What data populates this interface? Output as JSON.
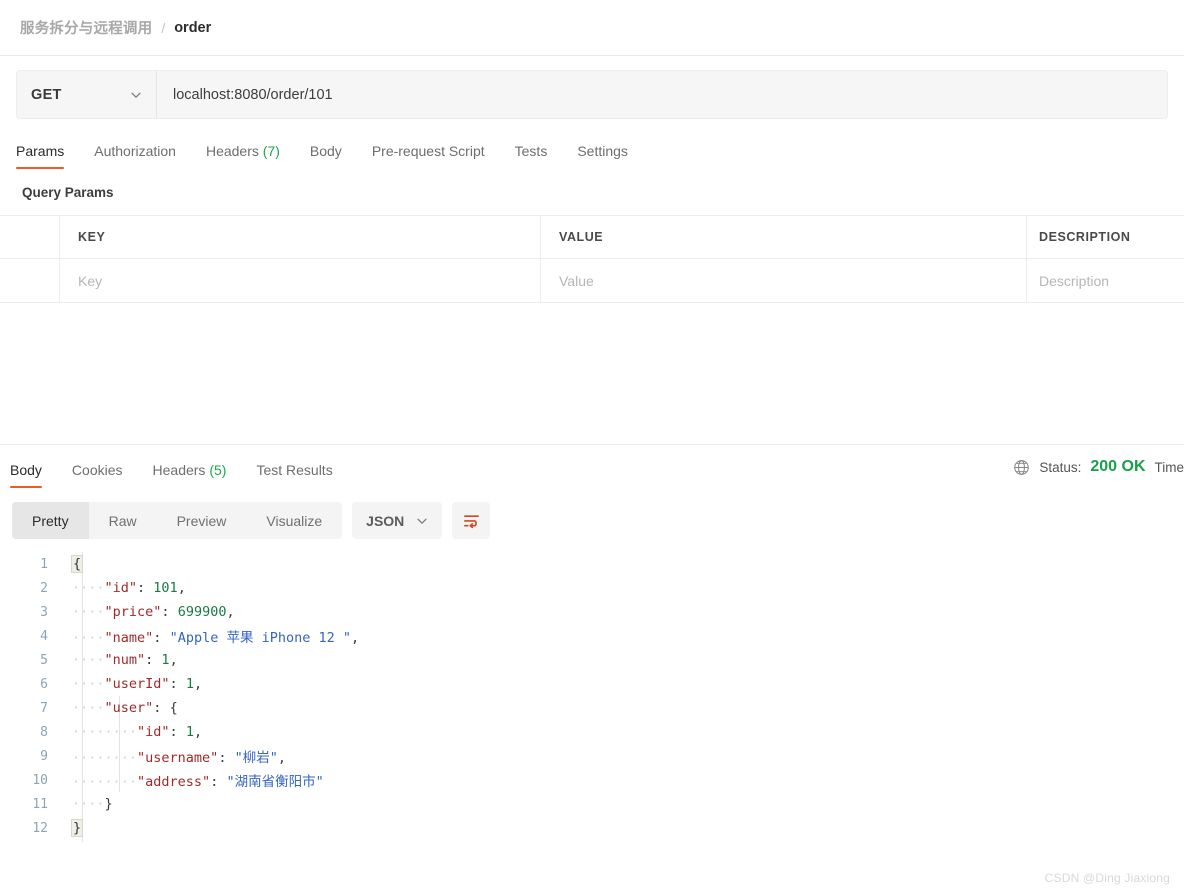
{
  "breadcrumb": {
    "collection": "服务拆分与远程调用",
    "separator": "/",
    "current": "order"
  },
  "request": {
    "method": "GET",
    "url": "localhost:8080/order/101",
    "tabs": [
      {
        "label": "Params",
        "active": true
      },
      {
        "label": "Authorization",
        "active": false
      },
      {
        "label": "Headers",
        "count": "(7)",
        "active": false
      },
      {
        "label": "Body",
        "active": false
      },
      {
        "label": "Pre-request Script",
        "active": false
      },
      {
        "label": "Tests",
        "active": false
      },
      {
        "label": "Settings",
        "active": false
      }
    ]
  },
  "query_params": {
    "title": "Query Params",
    "columns": [
      "KEY",
      "VALUE",
      "DESCRIPTION"
    ],
    "placeholder_row": {
      "key": "Key",
      "value": "Value",
      "description": "Description"
    }
  },
  "response": {
    "tabs": [
      {
        "label": "Body",
        "active": true
      },
      {
        "label": "Cookies",
        "active": false
      },
      {
        "label": "Headers",
        "count": "(5)",
        "active": false
      },
      {
        "label": "Test Results",
        "active": false
      }
    ],
    "status_label": "Status:",
    "status_value": "200 OK",
    "time_label": "Time",
    "globe_icon": "globe-icon",
    "view_modes": [
      {
        "label": "Pretty",
        "active": true
      },
      {
        "label": "Raw",
        "active": false
      },
      {
        "label": "Preview",
        "active": false
      },
      {
        "label": "Visualize",
        "active": false
      }
    ],
    "format": "JSON",
    "wrap_icon": "word-wrap-icon"
  },
  "code": {
    "lines": [
      {
        "no": "1",
        "segments": [
          {
            "t": "{",
            "c": "brace"
          }
        ]
      },
      {
        "no": "2",
        "segments": [
          {
            "t": "····",
            "c": "dots"
          },
          {
            "t": "\"id\"",
            "c": "k"
          },
          {
            "t": ": ",
            "c": "p"
          },
          {
            "t": "101",
            "c": "n"
          },
          {
            "t": ",",
            "c": "p"
          }
        ]
      },
      {
        "no": "3",
        "segments": [
          {
            "t": "····",
            "c": "dots"
          },
          {
            "t": "\"price\"",
            "c": "k"
          },
          {
            "t": ": ",
            "c": "p"
          },
          {
            "t": "699900",
            "c": "n"
          },
          {
            "t": ",",
            "c": "p"
          }
        ]
      },
      {
        "no": "4",
        "segments": [
          {
            "t": "····",
            "c": "dots"
          },
          {
            "t": "\"name\"",
            "c": "k"
          },
          {
            "t": ": ",
            "c": "p"
          },
          {
            "t": "\"Apple 苹果 iPhone 12 \"",
            "c": "s"
          },
          {
            "t": ",",
            "c": "p"
          }
        ]
      },
      {
        "no": "5",
        "segments": [
          {
            "t": "····",
            "c": "dots"
          },
          {
            "t": "\"num\"",
            "c": "k"
          },
          {
            "t": ": ",
            "c": "p"
          },
          {
            "t": "1",
            "c": "n"
          },
          {
            "t": ",",
            "c": "p"
          }
        ]
      },
      {
        "no": "6",
        "segments": [
          {
            "t": "····",
            "c": "dots"
          },
          {
            "t": "\"userId\"",
            "c": "k"
          },
          {
            "t": ": ",
            "c": "p"
          },
          {
            "t": "1",
            "c": "n"
          },
          {
            "t": ",",
            "c": "p"
          }
        ]
      },
      {
        "no": "7",
        "segments": [
          {
            "t": "····",
            "c": "dots"
          },
          {
            "t": "\"user\"",
            "c": "k"
          },
          {
            "t": ": ",
            "c": "p"
          },
          {
            "t": "{",
            "c": "p"
          }
        ]
      },
      {
        "no": "8",
        "segments": [
          {
            "t": "····",
            "c": "dots"
          },
          {
            "t": "····",
            "c": "dots"
          },
          {
            "t": "\"id\"",
            "c": "k"
          },
          {
            "t": ": ",
            "c": "p"
          },
          {
            "t": "1",
            "c": "n"
          },
          {
            "t": ",",
            "c": "p"
          }
        ]
      },
      {
        "no": "9",
        "segments": [
          {
            "t": "····",
            "c": "dots"
          },
          {
            "t": "····",
            "c": "dots"
          },
          {
            "t": "\"username\"",
            "c": "k"
          },
          {
            "t": ": ",
            "c": "p"
          },
          {
            "t": "\"柳岩\"",
            "c": "s"
          },
          {
            "t": ",",
            "c": "p"
          }
        ]
      },
      {
        "no": "10",
        "segments": [
          {
            "t": "····",
            "c": "dots"
          },
          {
            "t": "····",
            "c": "dots"
          },
          {
            "t": "\"address\"",
            "c": "k"
          },
          {
            "t": ": ",
            "c": "p"
          },
          {
            "t": "\"湖南省衡阳市\"",
            "c": "s"
          }
        ]
      },
      {
        "no": "11",
        "segments": [
          {
            "t": "····",
            "c": "dots"
          },
          {
            "t": "}",
            "c": "p"
          }
        ]
      },
      {
        "no": "12",
        "segments": [
          {
            "t": "}",
            "c": "brace"
          }
        ]
      }
    ]
  },
  "watermark": "CSDN @Ding Jiaxiong",
  "colors": {
    "accent": "#ef5b25",
    "success": "#18a04a",
    "json_key": "#a02a2a",
    "json_number": "#1a7a46",
    "json_string": "#3464c4"
  }
}
